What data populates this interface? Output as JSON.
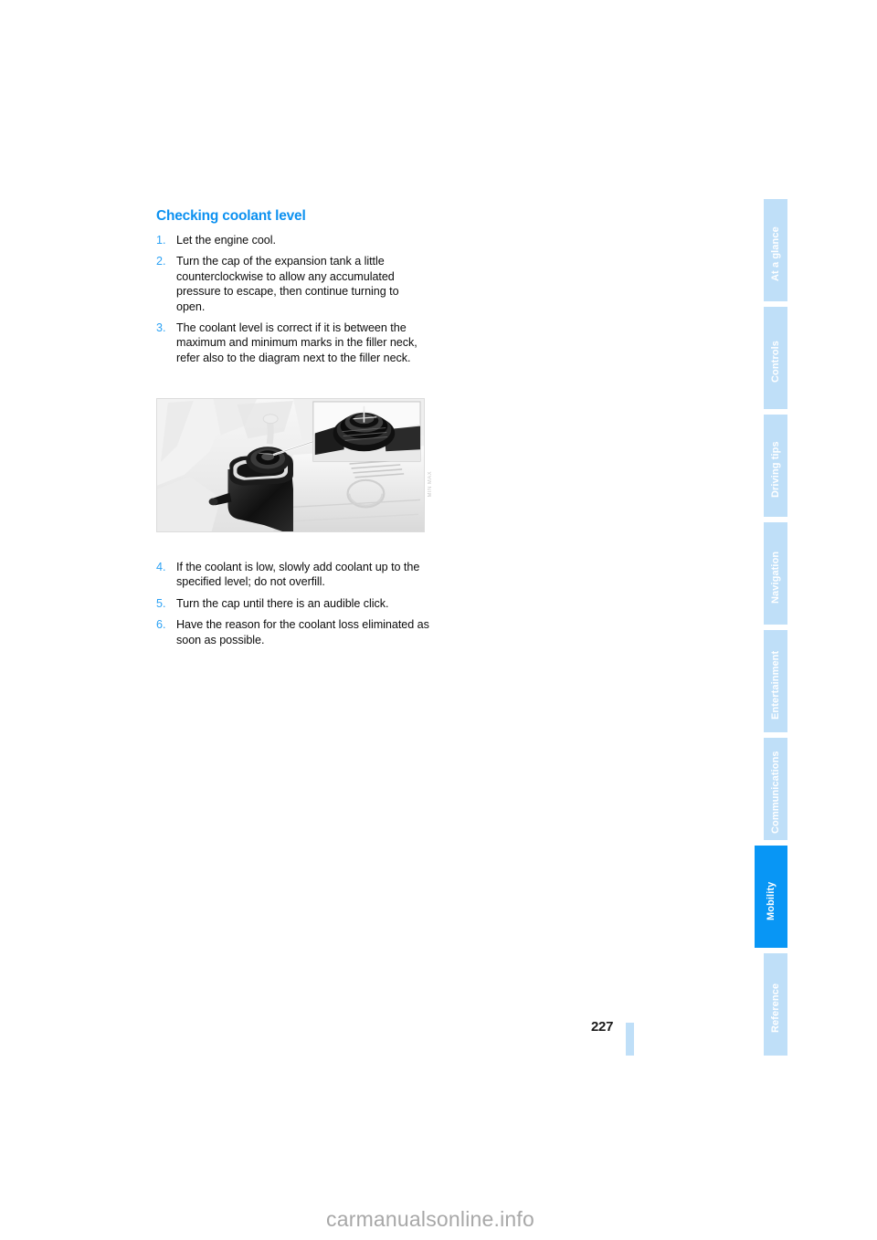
{
  "document": {
    "section_title": "Checking coolant level",
    "page_number": "227",
    "watermark": "carmanualsonline.info",
    "accent_color": "#0d91f0",
    "number_color": "#2ca2f5",
    "tab_color": "#bfdff8",
    "active_tab_color": "#0896f5"
  },
  "steps_upper": [
    {
      "num": "1.",
      "text": "Let the engine cool."
    },
    {
      "num": "2.",
      "text": "Turn the cap of the expansion tank a little counterclockwise to allow any accumulated pressure to escape, then continue turning to open."
    },
    {
      "num": "3.",
      "text": "The coolant level is correct if it is between the maximum and minimum marks in the filler neck, refer also to the diagram next to the filler neck."
    }
  ],
  "steps_lower": [
    {
      "num": "4.",
      "text": "If the coolant is low, slowly add coolant up to the specified level; do not overfill."
    },
    {
      "num": "5.",
      "text": "Turn the cap until there is an audible click."
    },
    {
      "num": "6.",
      "text": "Have the reason for the coolant loss eliminated as soon as possible."
    }
  ],
  "figure": {
    "caption_code": "MIN MAX",
    "alt": "Engine bay photograph showing the coolant expansion tank with an inset close-up of the filler neck cap"
  },
  "tabs": [
    {
      "label": "At a glance",
      "active": false
    },
    {
      "label": "Controls",
      "active": false
    },
    {
      "label": "Driving tips",
      "active": false
    },
    {
      "label": "Navigation",
      "active": false
    },
    {
      "label": "Entertainment",
      "active": false
    },
    {
      "label": "Communications",
      "active": false
    },
    {
      "label": "Mobility",
      "active": true
    },
    {
      "label": "Reference",
      "active": false
    }
  ]
}
